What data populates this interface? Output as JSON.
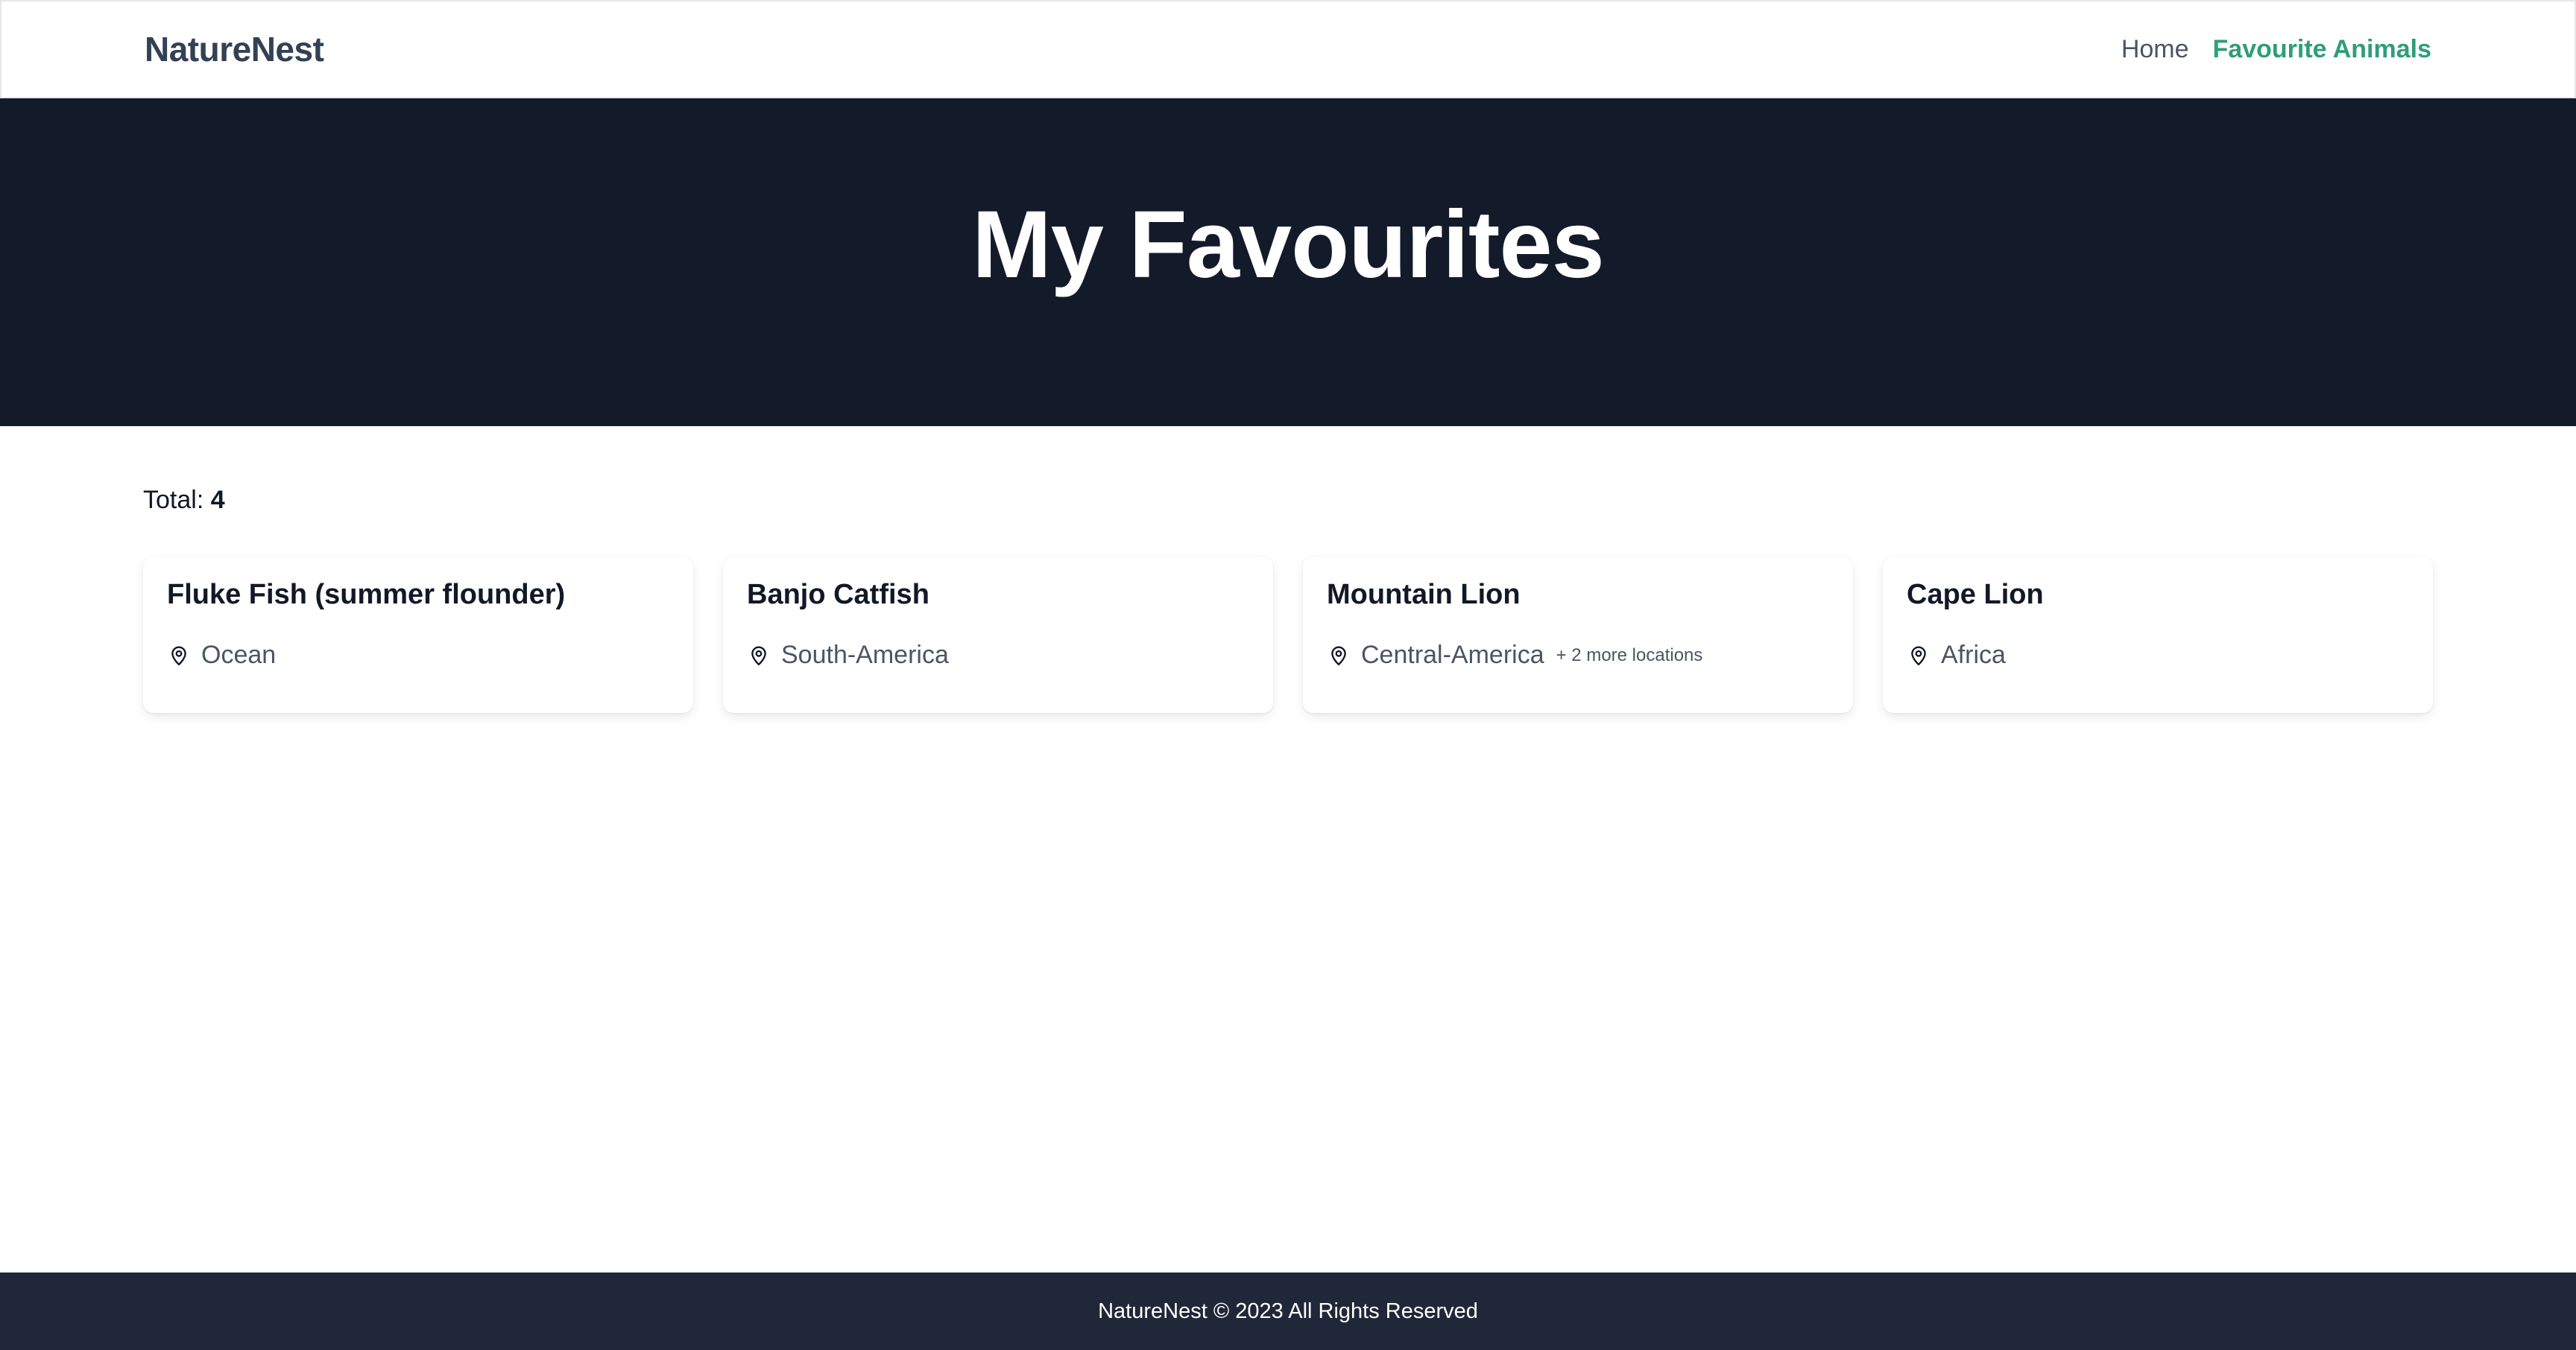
{
  "header": {
    "brand": "NatureNest",
    "nav": [
      {
        "label": "Home"
      },
      {
        "label": "Favourite Animals"
      }
    ]
  },
  "hero": {
    "title": "My Favourites"
  },
  "summary": {
    "total_label": "Total:",
    "total_count": "4"
  },
  "cards": [
    {
      "title": "Fluke Fish (summer flounder)",
      "location": "Ocean",
      "more": ""
    },
    {
      "title": "Banjo Catfish",
      "location": "South-America",
      "more": ""
    },
    {
      "title": "Mountain Lion",
      "location": "Central-America",
      "more": "+ 2 more locations"
    },
    {
      "title": "Cape Lion",
      "location": "Africa",
      "more": ""
    }
  ],
  "footer": {
    "text": "NatureNest © 2023 All Rights Reserved"
  },
  "colors": {
    "accent": "#2f9e77",
    "hero_bg": "#131a2a",
    "footer_bg": "#1f2738"
  },
  "icons": {
    "location": "map-pin-icon"
  }
}
